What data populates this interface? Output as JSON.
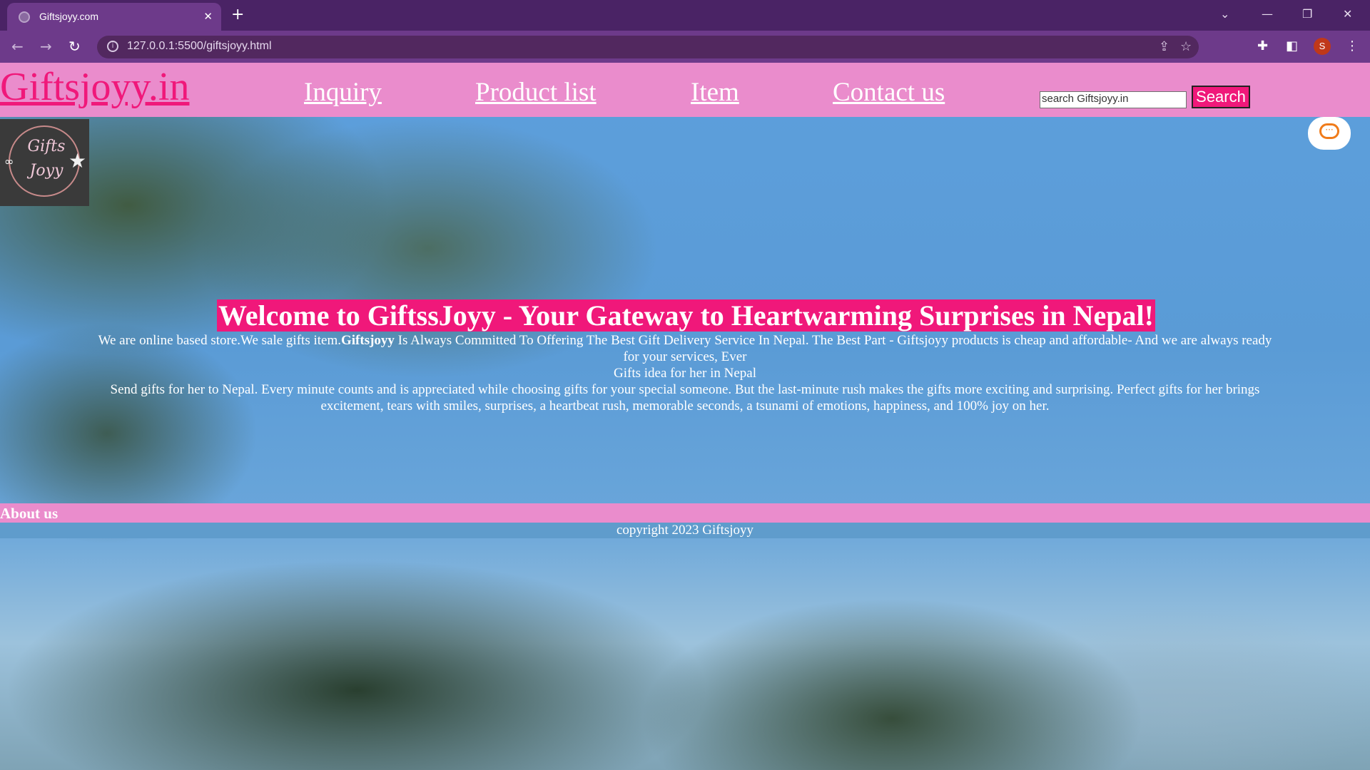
{
  "browser": {
    "tab_title": "Giftsjoyy.com",
    "tab_close": "✕",
    "new_tab": "+",
    "url": "127.0.0.1:5500/giftsjoyy.html",
    "profile_initial": "S",
    "icons": [
      "back-arrow-icon",
      "forward-arrow-icon",
      "reload-icon",
      "site-info-icon",
      "share-icon",
      "bookmark-star-icon",
      "extensions-icon",
      "side-panel-icon",
      "profile-avatar",
      "menu-dots-icon"
    ]
  },
  "header": {
    "brand": "Giftsjoyy.in",
    "nav": [
      "Inquiry",
      "Product list",
      "Item",
      "Contact us"
    ],
    "search_placeholder": "search Giftsjoyy.in",
    "search_button": "Search"
  },
  "logo": {
    "line1": "Gifts",
    "line2": "Joyy"
  },
  "hero": {
    "title": "Welcome to GiftssJoyy - Your Gateway to Heartwarming Surprises in Nepal!",
    "p1_start": "We are online based store.We sale gifts item.",
    "p1_bold": "Giftsjoyy",
    "p1_end": " Is Always Committed To Offering The Best Gift Delivery Service In Nepal. The Best Part - Giftsjoyy products is cheap and affordable- And we are always ready for your services, Ever",
    "p2": "Gifts idea for her in Nepal",
    "p3": "Send gifts for her to Nepal. Every minute counts and is appreciated while choosing gifts for your special someone. But the last-minute rush makes the gifts more exciting and surprising. Perfect gifts for her brings excitement, tears with smiles, surprises, a heartbeat rush, memorable seconds, a tsunami of emotions, happiness, and 100% joy on her."
  },
  "about": {
    "label": "About us"
  },
  "footer": {
    "text": "copyright 2023 Giftsjoyy"
  },
  "colors": {
    "header_pink": "#ea8ccc",
    "brand_magenta": "#f0187a",
    "browser_purple": "#6d3a8a",
    "footer_blue": "#5f9ccc"
  }
}
